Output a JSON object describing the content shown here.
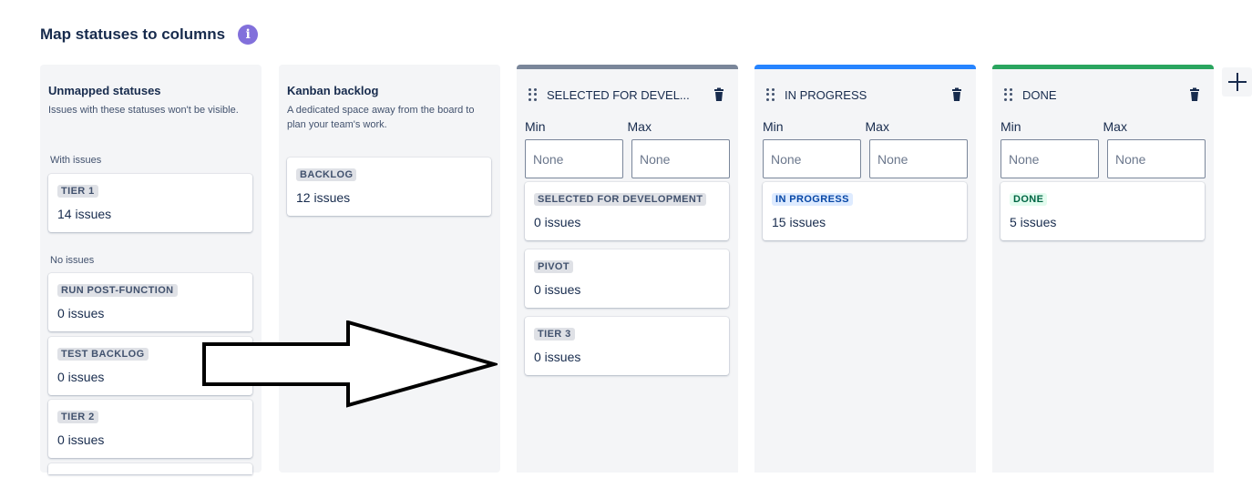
{
  "page": {
    "title": "Map statuses to columns",
    "info_icon": "info-icon",
    "info_glyph": "i"
  },
  "unmapped": {
    "heading": "Unmapped statuses",
    "description": "Issues with these statuses won't be visible.",
    "with_issues_label": "With issues",
    "no_issues_label": "No issues",
    "with_issues": [
      {
        "status": "TIER 1",
        "count": "14 issues"
      }
    ],
    "no_issues": [
      {
        "status": "RUN POST-FUNCTION",
        "count": "0 issues"
      },
      {
        "status": "TEST BACKLOG",
        "count": "0 issues"
      },
      {
        "status": "TIER 2",
        "count": "0 issues"
      }
    ]
  },
  "backlog": {
    "heading": "Kanban backlog",
    "description": "A dedicated space away from the board to plan your team's work.",
    "cards": [
      {
        "status": "BACKLOG",
        "count": "12 issues"
      }
    ]
  },
  "columns": [
    {
      "title": "SELECTED FOR DEVEL...",
      "accent": "#7a869a",
      "min_label": "Min",
      "max_label": "Max",
      "min_placeholder": "None",
      "max_placeholder": "None",
      "cards": [
        {
          "status": "SELECTED FOR DEVELOPMENT",
          "count": "0 issues"
        },
        {
          "status": "PIVOT",
          "count": "0 issues"
        },
        {
          "status": "TIER 3",
          "count": "0 issues"
        }
      ]
    },
    {
      "title": "IN PROGRESS",
      "accent": "#2684ff",
      "min_label": "Min",
      "max_label": "Max",
      "min_placeholder": "None",
      "max_placeholder": "None",
      "cards": [
        {
          "status": "IN PROGRESS",
          "count": "15 issues"
        }
      ]
    },
    {
      "title": "DONE",
      "accent": "#2aa55f",
      "min_label": "Min",
      "max_label": "Max",
      "min_placeholder": "None",
      "max_placeholder": "None",
      "cards": [
        {
          "status": "DONE",
          "count": "5 issues"
        }
      ]
    }
  ],
  "icons": {
    "drag": "drag-handle-icon",
    "delete": "trash-icon",
    "add": "plus-icon",
    "annotation": "right-arrow-annotation"
  }
}
